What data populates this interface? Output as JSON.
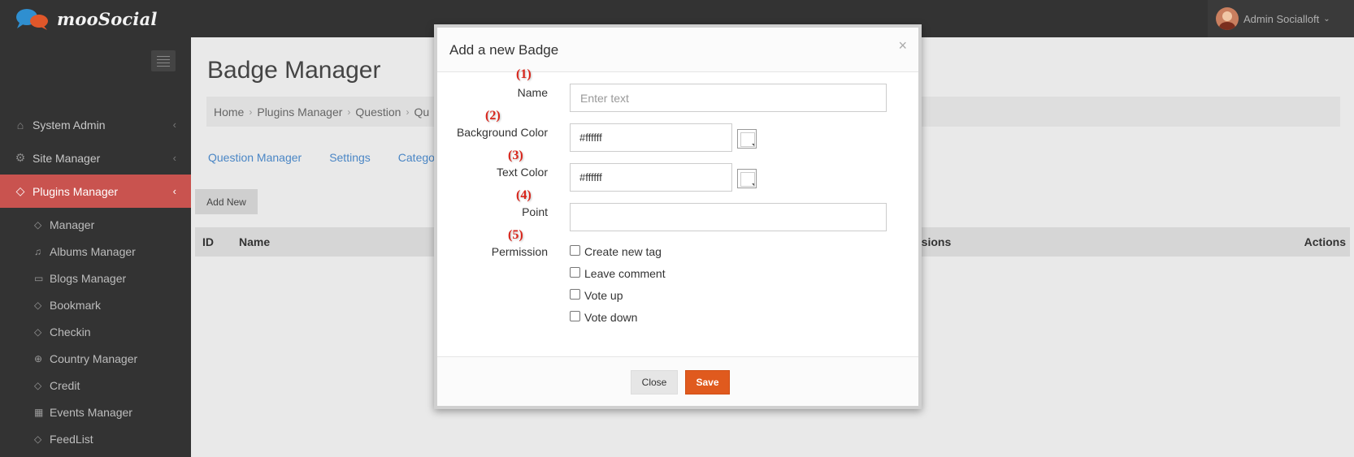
{
  "app": {
    "brand": "mooSocial"
  },
  "user": {
    "name": "Admin Socialloft"
  },
  "sidebar": {
    "items": [
      {
        "label": "System Admin",
        "icon": "home-icon",
        "active": false
      },
      {
        "label": "Site Manager",
        "icon": "gears-icon",
        "active": false
      },
      {
        "label": "Plugins Manager",
        "icon": "tag-icon",
        "active": true
      }
    ],
    "subitems": [
      {
        "label": "Manager",
        "icon": "tag-icon"
      },
      {
        "label": "Albums Manager",
        "icon": "album-icon"
      },
      {
        "label": "Blogs Manager",
        "icon": "comment-icon"
      },
      {
        "label": "Bookmark",
        "icon": "tag-icon"
      },
      {
        "label": "Checkin",
        "icon": "tag-icon"
      },
      {
        "label": "Country Manager",
        "icon": "globe-icon"
      },
      {
        "label": "Credit",
        "icon": "tag-icon"
      },
      {
        "label": "Events Manager",
        "icon": "calendar-icon"
      },
      {
        "label": "FeedList",
        "icon": "tag-icon"
      }
    ]
  },
  "page": {
    "title": "Badge Manager",
    "breadcrumb": [
      "Home",
      "Plugins Manager",
      "Question",
      "Qu"
    ],
    "tabs": [
      "Question Manager",
      "Settings",
      "Catego"
    ],
    "add_new": "Add New",
    "table_headers": {
      "id": "ID",
      "name": "Name",
      "permissions": "issions",
      "actions": "Actions"
    }
  },
  "modal": {
    "title": "Add a new Badge",
    "close_glyph": "×",
    "fields": {
      "name": {
        "step": "(1)",
        "label": "Name",
        "placeholder": "Enter text",
        "value": ""
      },
      "background_color": {
        "step": "(2)",
        "label": "Background Color",
        "value": "#ffffff"
      },
      "text_color": {
        "step": "(3)",
        "label": "Text Color",
        "value": "#ffffff"
      },
      "point": {
        "step": "(4)",
        "label": "Point",
        "value": ""
      },
      "permission": {
        "step": "(5)",
        "label": "Permission"
      }
    },
    "permissions": [
      "Create new tag",
      "Leave comment",
      "Vote up",
      "Vote down"
    ],
    "close_button": "Close",
    "save_button": "Save"
  },
  "colors": {
    "sidebar_active": "#c9534f",
    "save_button": "#e05a1e",
    "link": "#4a86c5",
    "step_marker": "#d9261c"
  }
}
